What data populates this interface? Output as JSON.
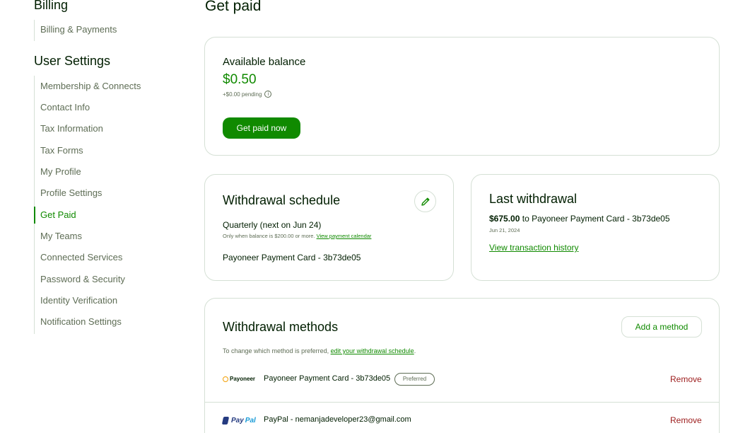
{
  "sidebar": {
    "billing_title": "Billing",
    "billing_items": [
      {
        "label": "Billing & Payments"
      }
    ],
    "user_settings_title": "User Settings",
    "user_items": [
      {
        "label": "Membership & Connects"
      },
      {
        "label": "Contact Info"
      },
      {
        "label": "Tax Information"
      },
      {
        "label": "Tax Forms"
      },
      {
        "label": "My Profile"
      },
      {
        "label": "Profile Settings"
      },
      {
        "label": "Get Paid",
        "active": true
      },
      {
        "label": "My Teams"
      },
      {
        "label": "Connected Services"
      },
      {
        "label": "Password & Security"
      },
      {
        "label": "Identity Verification"
      },
      {
        "label": "Notification Settings"
      }
    ]
  },
  "page": {
    "title": "Get paid"
  },
  "balance": {
    "label": "Available balance",
    "amount": "$0.50",
    "pending": "+$0.00 pending",
    "button": "Get paid now"
  },
  "schedule": {
    "title": "Withdrawal schedule",
    "frequency": "Quarterly (next on Jun 24)",
    "note": "Only when balance is $200.00 or more.",
    "note_link": "View payment calendar",
    "method": "Payoneer Payment Card - 3b73de05"
  },
  "last_withdrawal": {
    "title": "Last withdrawal",
    "amount": "$675.00",
    "destination": "to Payoneer Payment Card - 3b73de05",
    "date": "Jun 21, 2024",
    "link": "View transaction history"
  },
  "methods": {
    "title": "Withdrawal methods",
    "add_button": "Add a method",
    "note_prefix": "To change which method is preferred,",
    "note_link": "edit your withdrawal schedule",
    "note_suffix": ".",
    "items": [
      {
        "logo": "Payoneer",
        "name": "Payoneer Payment Card - 3b73de05",
        "badge": "Preferred",
        "remove": "Remove"
      },
      {
        "logo_a": "Pay",
        "logo_b": "Pal",
        "name": "PayPal - nemanjadeveloper23@gmail.com",
        "remove": "Remove"
      }
    ]
  },
  "colors": {
    "brand_green": "#108a00",
    "text_dark": "#001e00",
    "text_muted": "#5e6d55",
    "remove_red": "#9c1c1c",
    "border": "#d5e0d5"
  }
}
